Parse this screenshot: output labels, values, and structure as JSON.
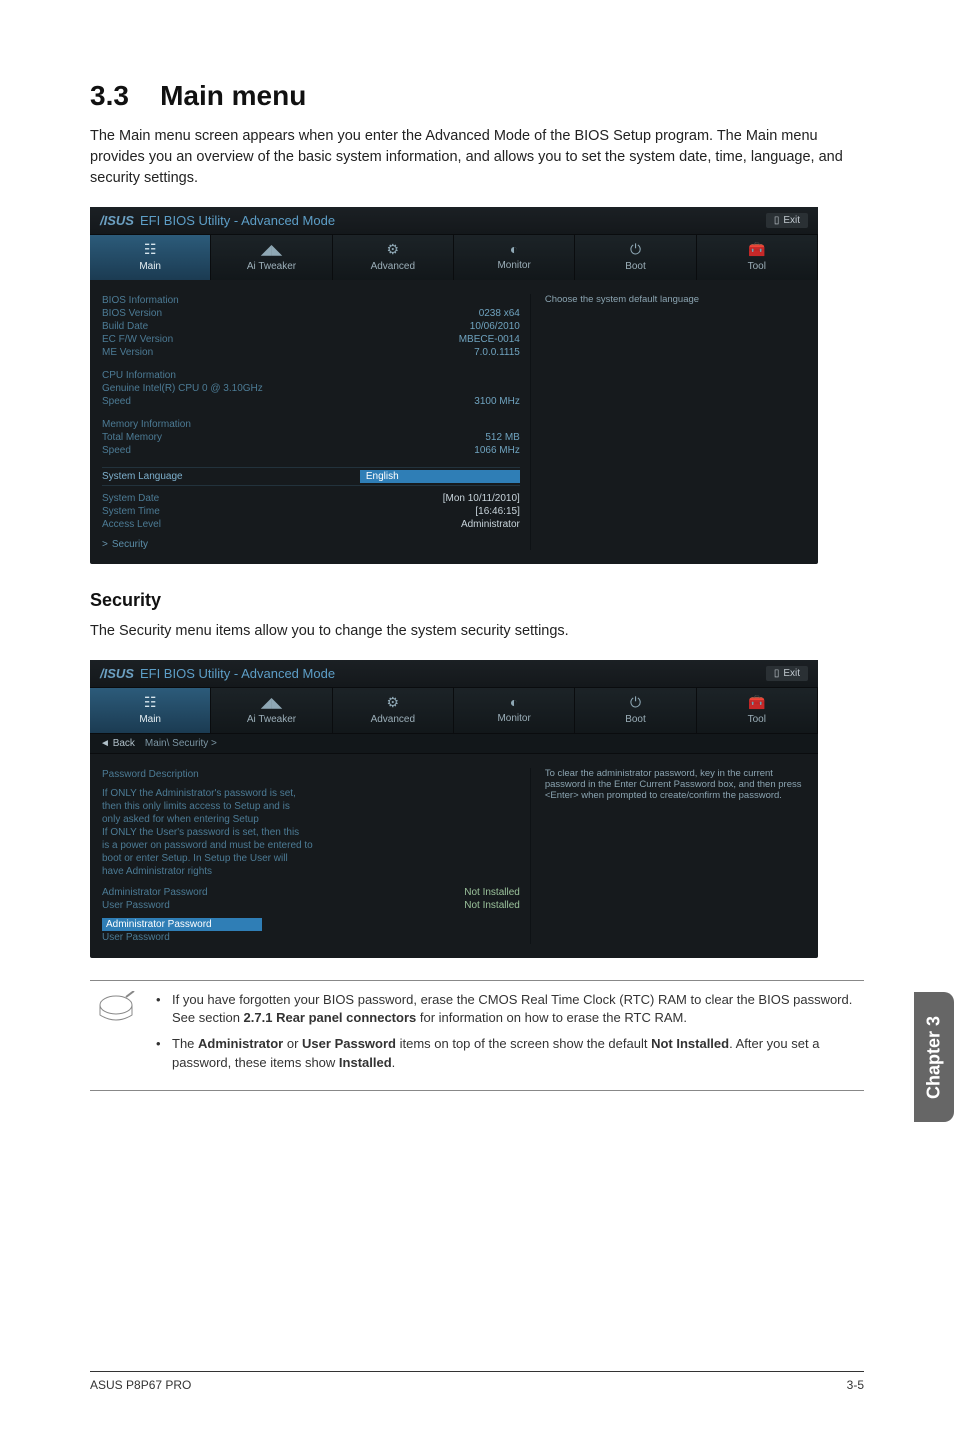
{
  "section": {
    "number": "3.3",
    "title": "Main menu"
  },
  "intro": "The Main menu screen appears when you enter the Advanced Mode of the BIOS Setup program. The Main menu provides you an overview of the basic system information, and allows you to set the system date, time, language, and security settings.",
  "bios_common": {
    "logo": "/ISUS",
    "title": "EFI BIOS Utility - Advanced Mode",
    "exit": "Exit",
    "tabs": [
      "Main",
      "Ai Tweaker",
      "Advanced",
      "Monitor",
      "Boot",
      "Tool"
    ]
  },
  "bios1": {
    "help": "Choose the system default language",
    "groups": {
      "bios_info": {
        "header": "BIOS Information",
        "rows": [
          {
            "label": "BIOS Version",
            "value": "0238 x64"
          },
          {
            "label": "Build Date",
            "value": "10/06/2010"
          },
          {
            "label": "EC F/W Version",
            "value": "MBECE-0014"
          },
          {
            "label": "ME Version",
            "value": "7.0.0.1115"
          }
        ]
      },
      "cpu_info": {
        "header": "CPU Information",
        "sub": "Genuine Intel(R) CPU 0 @ 3.10GHz",
        "rows": [
          {
            "label": "Speed",
            "value": "3100 MHz"
          }
        ]
      },
      "mem_info": {
        "header": "Memory Information",
        "rows": [
          {
            "label": "Total Memory",
            "value": "512 MB"
          },
          {
            "label": "Speed",
            "value": "1066 MHz"
          }
        ]
      }
    },
    "lang_label": "System Language",
    "lang_value": "English",
    "date_label": "System Date",
    "date_value": "[Mon 10/11/2010]",
    "time_label": "System Time",
    "time_value": "[16:46:15]",
    "access_label": "Access Level",
    "access_value": "Administrator",
    "security_link": "Security"
  },
  "security": {
    "heading": "Security",
    "intro": "The Security menu items allow you to change the system security settings."
  },
  "bios2": {
    "breadcrumb_back": "Back",
    "breadcrumb_path": "Main\\ Security  >",
    "help": "To clear the administrator password, key in the current password in the Enter Current Password box, and then press <Enter> when prompted to create/confirm the password.",
    "desc_header": "Password Description",
    "desc_lines": [
      "If ONLY the Administrator's password is set,",
      "then this only limits access to Setup and is",
      "only asked for when entering Setup",
      "If ONLY the User's password is set, then this",
      "is a power on password and must be entered to",
      "boot or enter Setup. In Setup the User will",
      "have Administrator rights"
    ],
    "rows": [
      {
        "label": "Administrator Password",
        "value": "Not Installed"
      },
      {
        "label": "User Password",
        "value": "Not Installed"
      }
    ],
    "selected": "Administrator Password",
    "below": "User Password"
  },
  "note": {
    "item1_a": "If you have forgotten your BIOS password, erase the CMOS Real Time Clock (RTC) RAM to clear the BIOS password. See section ",
    "item1_b": "2.7.1 Rear panel connectors",
    "item1_c": " for information on how to erase the RTC RAM.",
    "item2_a": "The ",
    "item2_b": "Administrator",
    "item2_c": " or ",
    "item2_d": "User Password",
    "item2_e": " items on top of the screen show the default ",
    "item2_f": "Not Installed",
    "item2_g": ". After you set a password, these items show ",
    "item2_h": "Installed",
    "item2_i": "."
  },
  "sidetab": "Chapter 3",
  "footer": {
    "left": "ASUS P8P67 PRO",
    "right": "3-5"
  }
}
